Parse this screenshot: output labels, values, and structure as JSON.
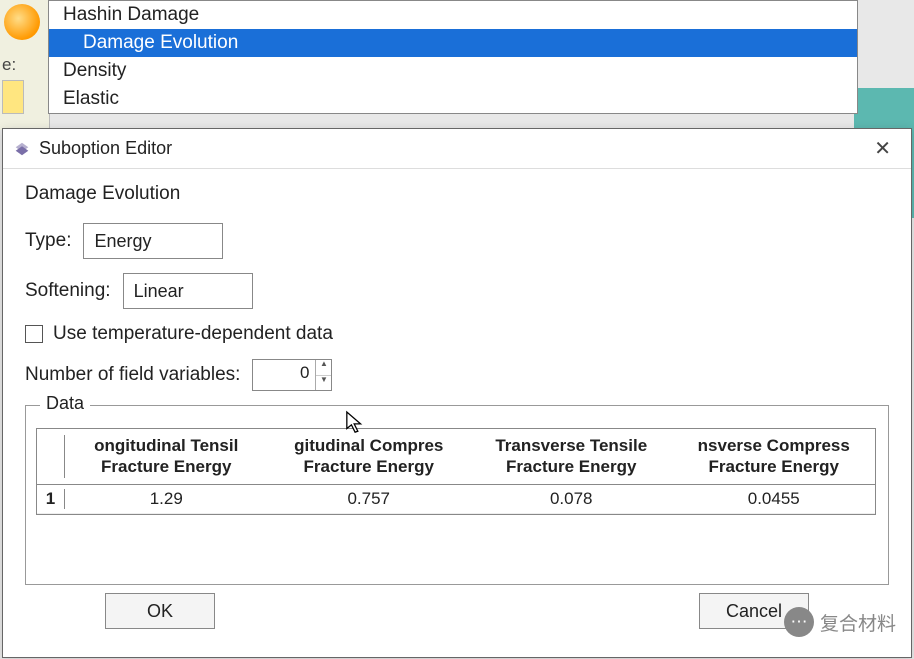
{
  "bg_list": {
    "items": [
      "Hashin Damage",
      "Damage Evolution",
      "Density",
      "Elastic"
    ],
    "selected_index": 1,
    "left_label": "e:"
  },
  "dialog": {
    "title": "Suboption Editor",
    "section": "Damage Evolution",
    "type_label": "Type:",
    "type_value": "Energy",
    "softening_label": "Softening:",
    "softening_value": "Linear",
    "temp_checkbox_label": "Use temperature-dependent data",
    "nfield_label": "Number of field variables:",
    "nfield_value": "0",
    "data_legend": "Data",
    "ok_label": "OK",
    "cancel_label": "Cancel"
  },
  "chart_data": {
    "type": "table",
    "columns": [
      "Longitudinal Tensile Fracture Energy",
      "Longitudinal Compressive Fracture Energy",
      "Transverse Tensile Fracture Energy",
      "Transverse Compressive Fracture Energy"
    ],
    "columns_display": [
      "ongitudinal Tensil\nFracture Energy",
      "gitudinal Compres\nFracture Energy",
      "Transverse Tensile\nFracture Energy",
      "nsverse Compress\nFracture Energy"
    ],
    "rows": [
      {
        "row": "1",
        "values": [
          "1.29",
          "0.757",
          "0.078",
          "0.0455"
        ]
      }
    ]
  },
  "watermark": {
    "text": "复合材料"
  }
}
